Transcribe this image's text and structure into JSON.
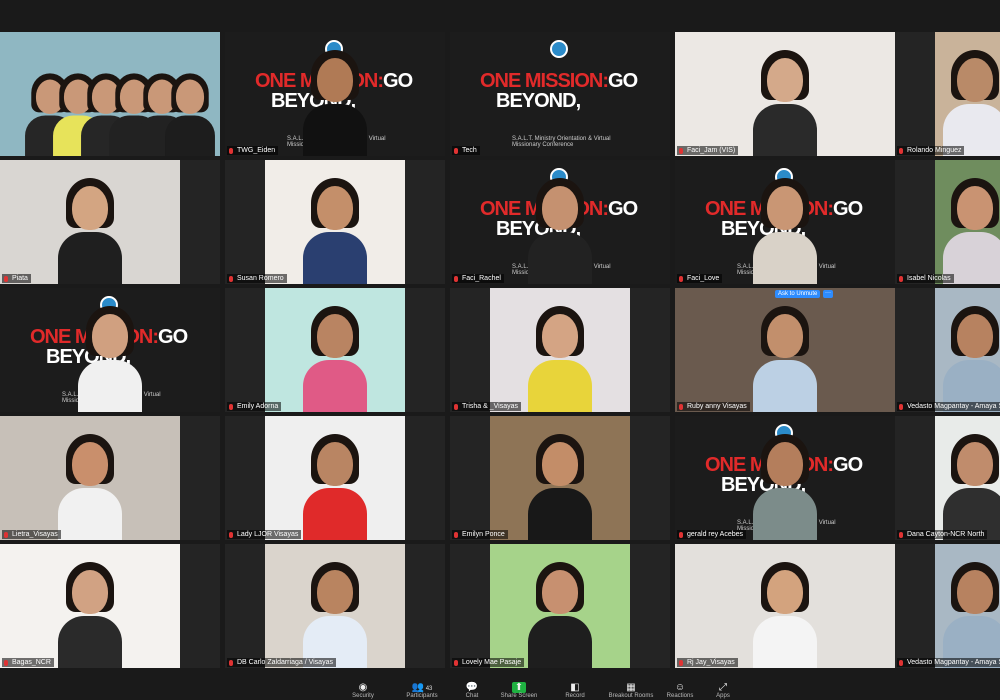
{
  "participants": [
    {
      "name": "",
      "bg": "#8fb7c2",
      "skin": "#c99878",
      "shirt": "#262626",
      "group": true
    },
    {
      "name": "TWG_Eiden",
      "banner": true,
      "skin": "#b07a55",
      "shirt": "#111"
    },
    {
      "name": "Tech",
      "banner": true
    },
    {
      "name": "Faci_Jam (VIS)",
      "bg": "#ece8e4",
      "skin": "#d4a98a",
      "shirt": "#2a2a2a"
    },
    {
      "name": "Rolando Minguez",
      "bg": "#c9b39a",
      "skin": "#b98a68",
      "shirt": "#e9e9ef"
    },
    {
      "name": "Piata",
      "bg": "#d9d6d2",
      "skin": "#d3a582",
      "shirt": "#1f1f1f"
    },
    {
      "name": "Susan Romero",
      "bg": "#f1ede8",
      "skin": "#c48f6a",
      "shirt": "#2a3f70"
    },
    {
      "name": "Faci_Rachel",
      "banner": true,
      "skin": "#c59170",
      "shirt": "#222"
    },
    {
      "name": "Faci_Love",
      "banner": true,
      "skin": "#c99674",
      "shirt": "#d9d2c8"
    },
    {
      "name": "Isabel Nicolas",
      "bg": "#6f8d5e",
      "skin": "#c99372",
      "shirt": "#d8d2d8"
    },
    {
      "name": "",
      "banner": true,
      "skin": "#d0a080",
      "shirt": "#f0f0f0"
    },
    {
      "name": "Emily Adorna",
      "bg": "#bfe6e0",
      "skin": "#b98462",
      "shirt": "#e05a86"
    },
    {
      "name": "Trisha & _Visayas",
      "bg": "#e4e0e2",
      "skin": "#d4a484",
      "shirt": "#e8d43a"
    },
    {
      "name": "Ruby anny Visayas",
      "bg": "#6a5a4e",
      "skin": "#c28f6c",
      "shirt": "#bcd0e4"
    },
    {
      "name": "Vedasto Magpantay - Amaya Shipping Inc.",
      "bg": "#a9b8c4",
      "skin": "#b78260",
      "shirt": "#9ab0c4"
    },
    {
      "name": "Lietra_Visayas",
      "bg": "#c7c0b8",
      "skin": "#c98f6c",
      "shirt": "#f1f1f1"
    },
    {
      "name": "Lady LJOR Visayas",
      "bg": "#efefef",
      "skin": "#b98563",
      "shirt": "#e02a2a"
    },
    {
      "name": "Emilyn Ponce",
      "bg": "#8e7456",
      "skin": "#c38d68",
      "shirt": "#181818"
    },
    {
      "name": "gerald rey Acebes",
      "banner": true,
      "skin": "#b47e5c",
      "shirt": "#7c8c8a"
    },
    {
      "name": "Dana Cayton-NCR North",
      "bg": "#e8ebe9",
      "skin": "#c08c6c",
      "shirt": "#2f2f2f"
    },
    {
      "name": "Bagas_NCR",
      "bg": "#f4f2ef",
      "skin": "#d1a283",
      "shirt": "#2a2a2a"
    },
    {
      "name": "DB Carlo Zaldarriaga / Visayas",
      "bg": "#dad4cc",
      "skin": "#b98460",
      "shirt": "#e4ecf6"
    },
    {
      "name": "Lovely Mae Pasaje",
      "bg": "#a6d38a",
      "skin": "#c79070",
      "shirt": "#1e1e1e"
    },
    {
      "name": "Rj Jay_Visayas",
      "bg": "#e3e0dc",
      "skin": "#d3a37e",
      "shirt": "#f4f4f4"
    },
    {
      "name": "Vedasto Magpantay - Amaya Shipping Inc.",
      "bg": "#a9b8c4",
      "skin": "#b78260",
      "shirt": "#9ab0c4"
    }
  ],
  "banner": {
    "line1a": "ONE MISSION:",
    "line1b": "GO",
    "line2": "BEYOND,",
    "line3": "S.A.L.T. Ministry Orientation & Virtual Missionary Conference"
  },
  "overlay": {
    "ask_to_unmute": "Ask to Unmute",
    "more": "···"
  },
  "toolbar": [
    {
      "icon": "◉",
      "label": "Security",
      "name": "security-icon"
    },
    {
      "icon": "👥",
      "label": "Participants",
      "name": "participants-icon",
      "count": "43"
    },
    {
      "icon": "💬",
      "label": "Chat",
      "name": "chat-icon"
    },
    {
      "icon": "⬆",
      "label": "Share Screen",
      "name": "share-screen-icon"
    },
    {
      "icon": "◧",
      "label": "Record",
      "name": "record-icon"
    },
    {
      "icon": "▦",
      "label": "Breakout Rooms",
      "name": "breakout-rooms-icon"
    },
    {
      "icon": "☺",
      "label": "Reactions",
      "name": "reactions-icon"
    },
    {
      "icon": "⤢",
      "label": "Apps",
      "name": "apps-icon"
    }
  ],
  "colors": {
    "active_speaker": "#c8d94a",
    "share_green": "#1fb141",
    "unmute_blue": "#2d8cff"
  }
}
